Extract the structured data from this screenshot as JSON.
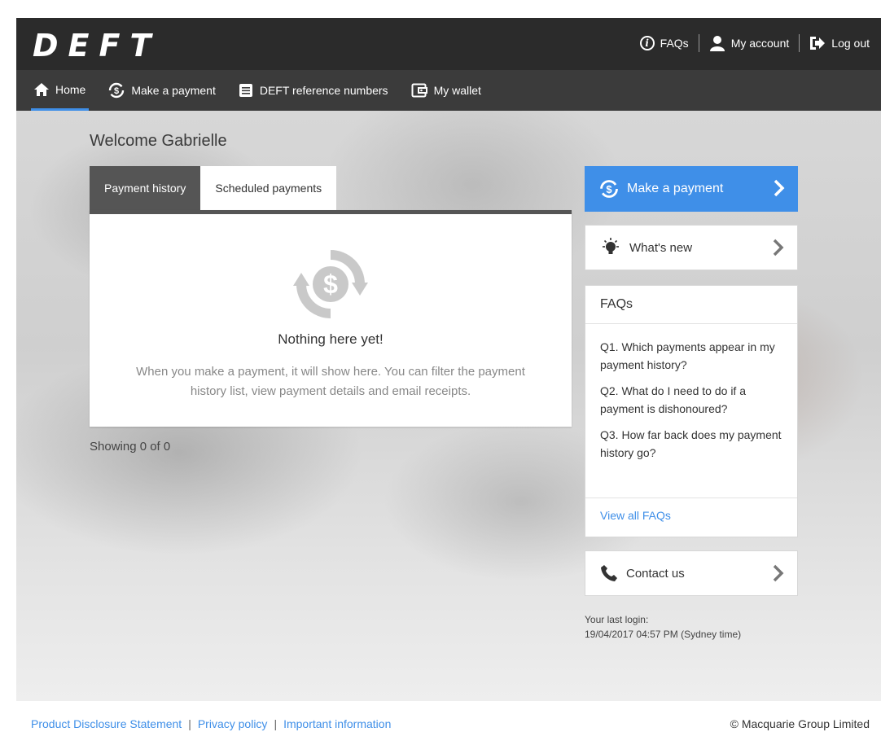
{
  "header": {
    "logo": "DEFT",
    "links": {
      "faqs": "FAQs",
      "account": "My account",
      "logout": "Log out"
    }
  },
  "nav": {
    "items": [
      "Home",
      "Make a payment",
      "DEFT reference numbers",
      "My wallet"
    ],
    "active": "Home"
  },
  "main": {
    "welcome": "Welcome Gabrielle",
    "tabs": [
      "Payment history",
      "Scheduled payments"
    ],
    "empty_title": "Nothing here yet!",
    "empty_text": "When you make a payment, it will show here. You can filter the payment history list, view payment details and email receipts.",
    "showing": "Showing 0 of 0"
  },
  "sidebar": {
    "make_payment": "Make a payment",
    "whats_new": "What's new",
    "faqs": {
      "title": "FAQs",
      "questions": [
        "Q1. Which payments appear in my payment history?",
        "Q2. What do I need to do if a payment is dishonoured?",
        "Q3. How far back does my payment history go?"
      ],
      "view_all": "View all FAQs"
    },
    "contact": "Contact us",
    "last_login": "Your last login:\n19/04/2017 04:57 PM (Sydney time)"
  },
  "footer": {
    "links": [
      "Product Disclosure Statement",
      "Privacy policy",
      "Important information"
    ],
    "copyright": "© Macquarie Group Limited"
  },
  "colors": {
    "accent": "#3f8fe8",
    "header_bg": "#2b2b2b",
    "nav_bg": "#3b3b3b",
    "tab_active": "#555555"
  }
}
